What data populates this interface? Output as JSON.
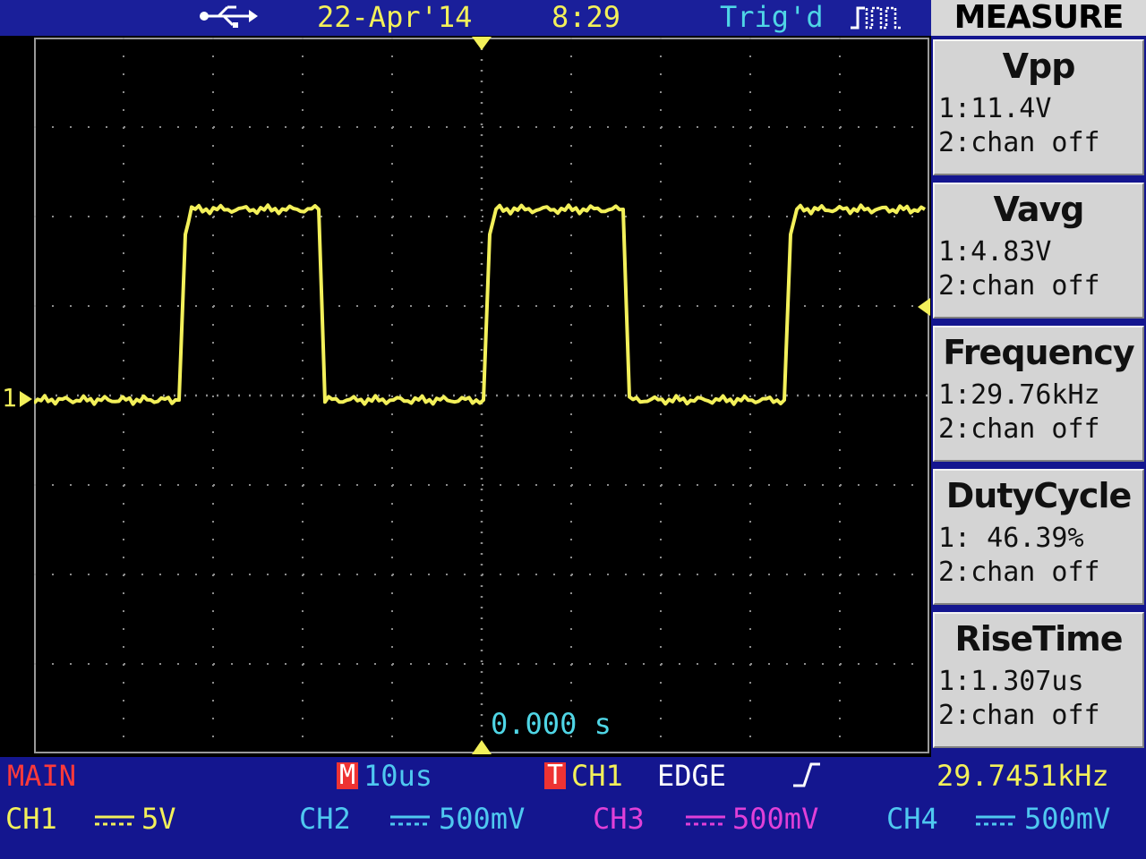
{
  "topbar": {
    "date": "22-Apr'14",
    "time": "8:29",
    "status": "Trig'd"
  },
  "measure_panel": {
    "title": "MEASURE",
    "items": [
      {
        "name": "Vpp",
        "ch1": "1:11.4V",
        "ch2": "2:chan off"
      },
      {
        "name": "Vavg",
        "ch1": "1:4.83V",
        "ch2": "2:chan off"
      },
      {
        "name": "Frequency",
        "ch1": "1:29.76kHz",
        "ch2": "2:chan off"
      },
      {
        "name": "DutyCycle",
        "ch1": "1: 46.39%",
        "ch2": "2:chan off"
      },
      {
        "name": "RiseTime",
        "ch1": "1:1.307us",
        "ch2": "2:chan off"
      }
    ]
  },
  "screen": {
    "time_offset": "0.000 s",
    "ch1_marker": "1"
  },
  "bottom": {
    "mode": "MAIN",
    "timebase_label": "M",
    "timebase": "10us",
    "trigger_label": "T",
    "trigger_source": "CH1",
    "trigger_type": "EDGE",
    "trigger_freq": "29.7451kHz",
    "channels": [
      {
        "name": "CH1",
        "scale": "5V",
        "color": "#f3f05a"
      },
      {
        "name": "CH2",
        "scale": "500mV",
        "color": "#4fc8f0"
      },
      {
        "name": "CH3",
        "scale": "500mV",
        "color": "#e040d8"
      },
      {
        "name": "CH4",
        "scale": "500mV",
        "color": "#4fc8f0"
      }
    ]
  },
  "colors": {
    "trace": "#f3f05a",
    "background": "#000000",
    "panel": "#14168f",
    "grid": "#8c8c8c"
  },
  "chart_data": {
    "type": "line",
    "title": "",
    "xlabel": "",
    "ylabel": "",
    "xlim": [
      -50,
      50
    ],
    "ylim": [
      -20,
      20
    ],
    "grid": true,
    "series": [
      {
        "x": [
          -50,
          -33.8,
          -33.1,
          -32.4,
          -18.2,
          -17.5,
          0.2,
          0.9,
          1.6,
          15.8,
          16.5,
          33.8,
          34.5,
          35.2,
          49.5
        ],
        "y": [
          -0.25,
          -0.25,
          9.0,
          10.4,
          10.4,
          -0.25,
          -0.25,
          9.0,
          10.4,
          10.4,
          -0.25,
          -0.25,
          9.0,
          10.4,
          10.4
        ]
      }
    ]
  }
}
